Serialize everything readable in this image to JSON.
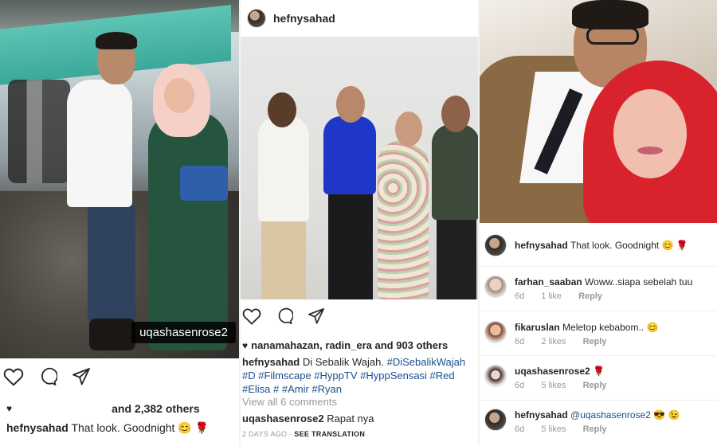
{
  "panel1": {
    "photo_tag": "uqashasenrose2",
    "likes_text": "and 2,382 others",
    "caption_user": "hefnysahad",
    "caption_text": "That look. Goodnight 😊 🌹"
  },
  "panel2": {
    "username": "hefnysahad",
    "liked_by": "nanamahazan, radin_era",
    "likes_rest": "and 903 others",
    "caption_user": "hefnysahad",
    "caption_text": "Di Sebalik Wajah.",
    "caption_tags": "#DiSebalikWajah #D #Filmscape #HyppTV #HyppSensasi #Red #Elisa # #Amir #Ryan",
    "view_all": "View all 6 comments",
    "comment_user": "uqashasenrose2",
    "comment_text": "Rapat nya",
    "time": "2 DAYS AGO",
    "see_translation": "SEE TRANSLATION"
  },
  "panel3": {
    "comments": [
      {
        "user": "hefnysahad",
        "text": "That look. Goodnight 😊 🌹",
        "meta": [],
        "mention": ""
      },
      {
        "user": "farhan_saaban",
        "text": "Woww..siapa sebelah tuu",
        "age": "6d",
        "likes": "1 like",
        "reply": "Reply",
        "mention": ""
      },
      {
        "user": "fikaruslan",
        "text": "Meletop kebabom.. 😊",
        "age": "6d",
        "likes": "2 likes",
        "reply": "Reply",
        "mention": ""
      },
      {
        "user": "uqashasenrose2",
        "text": "🌹",
        "age": "6d",
        "likes": "5 likes",
        "reply": "Reply",
        "mention": ""
      },
      {
        "user": "hefnysahad",
        "text": "😎 😉",
        "age": "6d",
        "likes": "5 likes",
        "reply": "Reply",
        "mention": "@uqashasenrose2"
      }
    ]
  },
  "icons": [
    "heart-icon",
    "comment-icon",
    "share-icon"
  ]
}
